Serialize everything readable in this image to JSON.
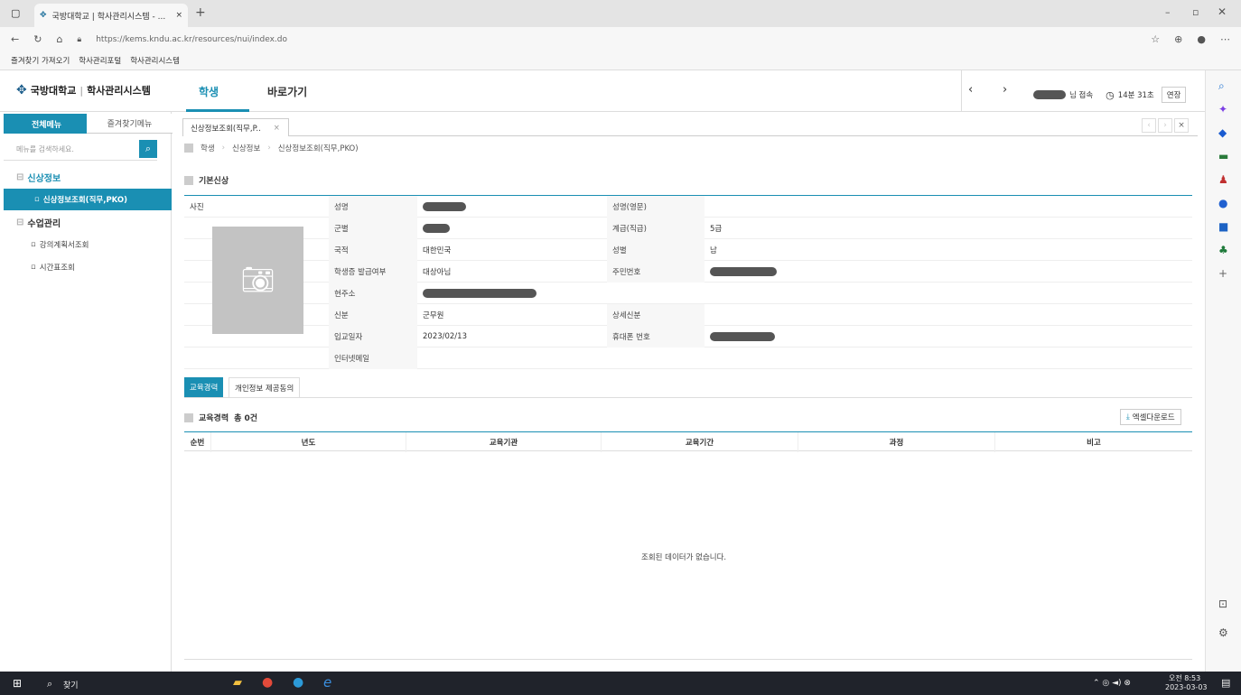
{
  "browser": {
    "tab_title": "국방대학교 | 학사관리시스템 - ...",
    "url": "https://kems.kndu.ac.kr/resources/nui/index.do",
    "favorites": [
      "즐겨찾기 가져오기",
      "학사관리포털",
      "학사관리시스템"
    ]
  },
  "app": {
    "logo_text": "국방대학교",
    "system_name": "학사관리시스템",
    "nav": [
      "학생",
      "바로가기"
    ],
    "user_suffix": "님 접속",
    "timer": "14분 31초",
    "extend_label": "연장"
  },
  "sidebar": {
    "tabs": [
      "전체메뉴",
      "즐겨찾기메뉴"
    ],
    "search_placeholder": "메뉴를 검색하세요.",
    "items": [
      {
        "label": "신상정보",
        "level": 0
      },
      {
        "label": "신상정보조회(직무,PKO)",
        "level": 1,
        "active": true
      },
      {
        "label": "수업관리",
        "level": 0
      },
      {
        "label": "강의계획서조회",
        "level": 1
      },
      {
        "label": "시간표조회",
        "level": 1
      }
    ]
  },
  "content": {
    "tab_label": "신상정보조회(직무,P..",
    "breadcrumb": [
      "학생",
      "신상정보",
      "신상정보조회(직무,PKO)"
    ],
    "section_title": "기본신상",
    "photo_label": "사진",
    "fields": {
      "name_label": "성명",
      "name_en_label": "성명(영문)",
      "branch_label": "군별",
      "rank_label": "계급(직급)",
      "rank_value": "5급",
      "nationality_label": "국적",
      "nationality_value": "대한민국",
      "sex_label": "성별",
      "sex_value": "남",
      "card_label": "학생증 발급여부",
      "card_value": "대상아님",
      "rrn_label": "주민번호",
      "address_label": "현주소",
      "status_label": "신분",
      "status_value": "군무원",
      "detail_status_label": "상세신분",
      "enroll_label": "입교일자",
      "enroll_value": "2023/02/13",
      "phone_label": "휴대폰 번호",
      "email_label": "인터넷메일"
    },
    "subtabs": [
      "교육경력",
      "개인정보 제공동의"
    ],
    "edu_title": "교육경력",
    "edu_count": "총 0건",
    "excel_label": "엑셀다운로드",
    "columns": [
      "순번",
      "년도",
      "교육기관",
      "교육기간",
      "과정",
      "비고"
    ],
    "empty_message": "조회된 데이터가 없습니다."
  },
  "taskbar": {
    "search_label": "찾기",
    "time": "오전 8:53",
    "date": "2023-03-03"
  },
  "colors": {
    "accent": "#1a8fb3"
  }
}
